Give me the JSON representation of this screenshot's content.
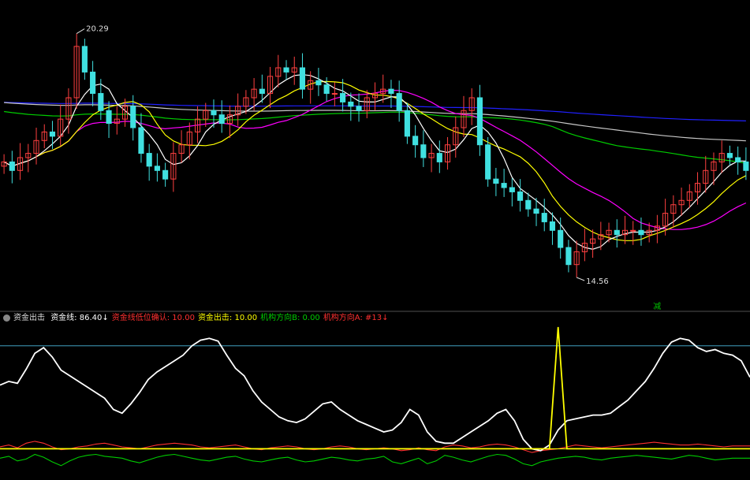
{
  "indicator": {
    "name": "资金出击",
    "items": [
      {
        "label": "资金线:",
        "value": "86.40",
        "arrow": "↓",
        "color": "#ffffff"
      },
      {
        "label": "资金线低位确认:",
        "value": "10.00",
        "arrow": "",
        "color": "#ff3030"
      },
      {
        "label": "资金出击:",
        "value": "10.00",
        "arrow": "",
        "color": "#ffff00"
      },
      {
        "label": "机构方向B:",
        "value": "0.00",
        "arrow": "",
        "color": "#00cc00"
      },
      {
        "label": "机构方向A:",
        "value": "#13",
        "arrow": "↓",
        "color": "#ff3030"
      }
    ]
  },
  "price_labels": {
    "high": "20.29",
    "low": "14.56"
  },
  "marker": {
    "text": "减",
    "color": "#00c000"
  },
  "colors": {
    "up": "#ff4040",
    "down": "#40e0e0",
    "ma5": "#ffffff",
    "ma10": "#ffff00",
    "ma20": "#ff00ff",
    "ma60": "#00cc00",
    "ma120": "#c8c8c8",
    "ma250": "#2020ff",
    "fund": "#ffffff",
    "trigger": "#ffff00",
    "orgA": "#ff3030",
    "orgB": "#00cc00",
    "ref_high": "#40a0c0"
  },
  "chart_data": [
    {
      "type": "candlestick",
      "price_range": [
        14.0,
        21.0
      ],
      "annotations": [
        {
          "text": "20.29",
          "kind": "high"
        },
        {
          "text": "14.56",
          "kind": "low"
        }
      ],
      "close": [
        17.4,
        17.2,
        17.5,
        17.6,
        17.9,
        18.1,
        18.0,
        18.4,
        18.9,
        20.1,
        19.5,
        19.0,
        18.6,
        18.3,
        18.4,
        18.7,
        18.2,
        17.6,
        17.3,
        17.2,
        17.0,
        17.6,
        17.8,
        18.1,
        18.4,
        18.6,
        18.5,
        18.3,
        18.5,
        18.7,
        18.9,
        19.1,
        19.0,
        19.4,
        19.6,
        19.5,
        19.6,
        19.1,
        19.3,
        19.2,
        19.0,
        19.0,
        18.8,
        18.7,
        18.6,
        18.9,
        19.0,
        19.1,
        19.0,
        18.6,
        18.0,
        17.8,
        17.5,
        17.6,
        17.4,
        17.8,
        18.2,
        18.6,
        18.9,
        17.8,
        17.0,
        16.9,
        16.8,
        16.7,
        16.5,
        16.3,
        16.2,
        16.0,
        15.8,
        15.4,
        15.0,
        15.3,
        15.5,
        15.6,
        15.7,
        15.8,
        15.7,
        15.8,
        15.8,
        15.7,
        15.8,
        15.9,
        16.2,
        16.4,
        16.5,
        16.7,
        16.9,
        17.2,
        17.4,
        17.6,
        17.5,
        17.4,
        17.2
      ],
      "series": [
        {
          "name": "资金线",
          "values": [
            78,
            82,
            80,
            95,
            112,
            118,
            108,
            94,
            88,
            82,
            76,
            70,
            64,
            52,
            48,
            58,
            70,
            84,
            92,
            98,
            104,
            110,
            120,
            126,
            128,
            125,
            110,
            96,
            88,
            72,
            60,
            52,
            44,
            40,
            38,
            42,
            50,
            58,
            60,
            52,
            46,
            40,
            36,
            32,
            28,
            30,
            38,
            52,
            46,
            28,
            18,
            16,
            16,
            22,
            28,
            34,
            40,
            48,
            52,
            40,
            20,
            10,
            8,
            14,
            30,
            40,
            42,
            44,
            46,
            46,
            48,
            55,
            62,
            72,
            82,
            96,
            112,
            124,
            128,
            126,
            118,
            114,
            116,
            112,
            110,
            104,
            86.4
          ]
        },
        {
          "name": "资金线低位确认",
          "values": [
            10,
            10,
            10,
            10,
            10,
            10,
            10,
            10,
            10,
            10,
            10,
            10,
            10,
            10,
            10,
            10,
            10,
            10,
            10,
            10,
            10,
            10,
            10,
            10,
            10,
            10,
            10,
            10,
            10,
            10,
            10,
            10,
            10,
            10,
            10,
            10,
            10,
            10,
            10,
            10,
            10,
            10,
            10,
            10,
            10,
            10,
            10,
            10,
            10,
            10,
            10,
            10,
            10,
            10,
            10,
            10,
            10,
            10,
            10,
            10,
            10,
            10,
            10,
            10,
            10,
            10,
            10,
            10,
            10,
            10,
            10,
            10,
            10,
            10,
            10,
            10,
            10,
            10,
            10,
            10,
            10,
            10,
            10,
            10,
            10,
            10,
            10
          ]
        },
        {
          "name": "资金出击",
          "values": [
            10,
            10,
            10,
            10,
            10,
            10,
            10,
            10,
            10,
            10,
            10,
            10,
            10,
            10,
            10,
            10,
            10,
            10,
            10,
            10,
            10,
            10,
            10,
            10,
            10,
            10,
            10,
            10,
            10,
            10,
            10,
            10,
            10,
            10,
            10,
            10,
            10,
            10,
            10,
            10,
            10,
            10,
            10,
            10,
            10,
            10,
            10,
            10,
            10,
            10,
            10,
            10,
            10,
            10,
            10,
            10,
            10,
            10,
            10,
            10,
            10,
            10,
            10,
            10,
            140,
            10,
            10,
            10,
            10,
            10,
            10,
            10,
            10,
            10,
            10,
            10,
            10,
            10,
            10,
            10,
            10,
            10,
            10,
            10,
            10,
            10,
            10
          ]
        },
        {
          "name": "机构方向B",
          "values": [
            0,
            2,
            -3,
            -1,
            4,
            1,
            -4,
            -8,
            -3,
            1,
            3,
            4,
            2,
            1,
            0,
            -3,
            -5,
            -2,
            1,
            3,
            4,
            2,
            0,
            -2,
            -3,
            -1,
            1,
            2,
            -1,
            -3,
            -4,
            -2,
            0,
            1,
            -2,
            -4,
            -3,
            -1,
            1,
            0,
            -2,
            -3,
            -1,
            0,
            2,
            -4,
            -6,
            -3,
            0,
            -6,
            -3,
            3,
            1,
            -2,
            -4,
            -1,
            2,
            4,
            3,
            -1,
            -6,
            -8,
            -4,
            -2,
            0,
            1,
            2,
            1,
            -1,
            -2,
            0,
            1,
            2,
            3,
            2,
            1,
            0,
            -1,
            1,
            3,
            2,
            0,
            -2,
            -1,
            0,
            0,
            0
          ]
        },
        {
          "name": "机构方向A",
          "values": [
            12,
            14,
            11,
            16,
            18,
            16,
            12,
            9,
            10,
            12,
            13,
            15,
            16,
            14,
            12,
            11,
            10,
            12,
            14,
            15,
            16,
            15,
            14,
            12,
            11,
            12,
            13,
            14,
            12,
            10,
            9,
            11,
            12,
            13,
            12,
            10,
            9,
            10,
            12,
            13,
            12,
            10,
            9,
            10,
            11,
            10,
            8,
            9,
            11,
            9,
            8,
            12,
            14,
            13,
            11,
            12,
            14,
            15,
            14,
            12,
            9,
            6,
            8,
            9,
            10,
            12,
            14,
            13,
            12,
            11,
            12,
            13,
            14,
            15,
            16,
            17,
            16,
            15,
            14,
            14,
            15,
            14,
            13,
            12,
            13,
            13,
            13
          ]
        }
      ]
    }
  ]
}
